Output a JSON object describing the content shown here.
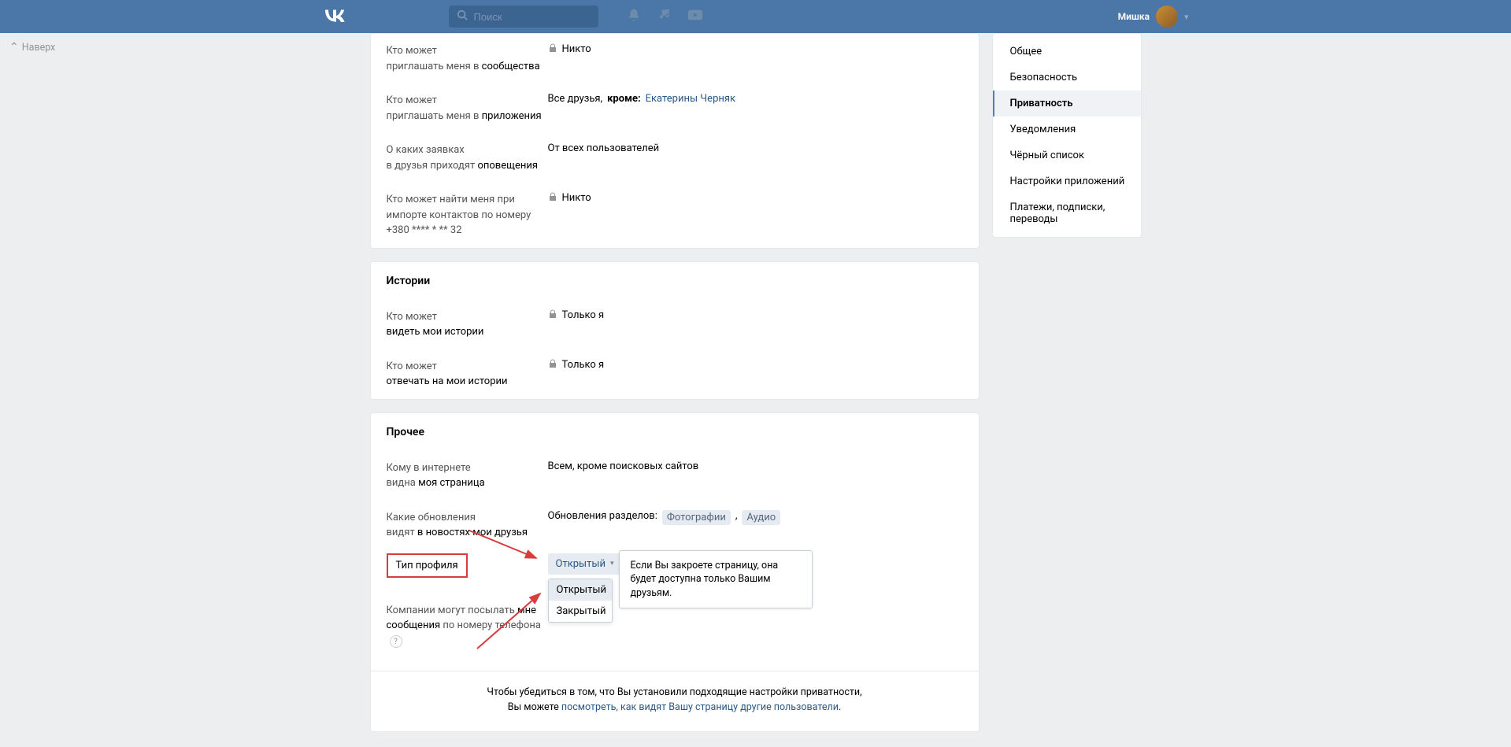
{
  "header": {
    "search_placeholder": "Поиск",
    "username": "Мишка"
  },
  "back_top": "Наверх",
  "sidebar": {
    "items": [
      {
        "label": "Общее",
        "active": false
      },
      {
        "label": "Безопасность",
        "active": false
      },
      {
        "label": "Приватность",
        "active": true
      },
      {
        "label": "Уведомления",
        "active": false
      },
      {
        "label": "Чёрный список",
        "active": false
      },
      {
        "label": "Настройки приложений",
        "active": false
      },
      {
        "label": "Платежи, подписки, переводы",
        "active": false
      }
    ]
  },
  "settings": {
    "invite_communities": {
      "label_1": "Кто может",
      "label_2": "приглашать меня в ",
      "label_bold": "сообщества",
      "value": "Никто",
      "locked": true
    },
    "invite_apps": {
      "label_1": "Кто может",
      "label_2": "приглашать меня в ",
      "label_bold": "приложения",
      "value_prefix": "Все друзья,",
      "value_bold": "кроме:",
      "value_link": "Екатерины Черняк"
    },
    "friend_notifications": {
      "label_1": "О каких заявках",
      "label_2": "в друзья приходят ",
      "label_bold": "оповещения",
      "value": "От всех пользователей"
    },
    "contact_import": {
      "label_1": "Кто может найти меня при импорте контактов по номеру +380 **** * ** 32",
      "value": "Никто",
      "locked": true
    }
  },
  "stories_title": "Истории",
  "stories": {
    "view": {
      "label_1": "Кто может",
      "label_2": "видеть мои истории",
      "value": "Только я",
      "locked": true
    },
    "reply": {
      "label_1": "Кто может",
      "label_2": "отвечать на мои истории",
      "value": "Только я",
      "locked": true
    }
  },
  "other_title": "Прочее",
  "other": {
    "page_visible": {
      "label_1": "Кому в интернете",
      "label_2": "видна ",
      "label_bold": "моя страница",
      "value": "Всем, кроме поисковых сайтов"
    },
    "news_updates": {
      "label_1": "Какие обновления",
      "label_2": "видят ",
      "label_bold": "в новостях мои друзья",
      "value_prefix": "Обновления разделов:",
      "tags": [
        "Фотографии",
        "Аудио"
      ]
    },
    "profile_type": {
      "label": "Тип профиля",
      "selected": "Открытый",
      "options": [
        "Открытый",
        "Закрытый"
      ],
      "tooltip": "Если Вы закроете страницу, она будет доступна только Вашим друзьям."
    },
    "company_messages": {
      "label_1": "Компании могут посылать ",
      "label_bold": "мне сообщения",
      "label_2": " по номеру телефона"
    }
  },
  "footer": {
    "text_1": "Чтобы убедиться в том, что Вы установили подходящие настройки приватности,",
    "text_2": "Вы можете ",
    "link": "посмотреть, как видят Вашу страницу другие пользователи",
    "period": "."
  }
}
